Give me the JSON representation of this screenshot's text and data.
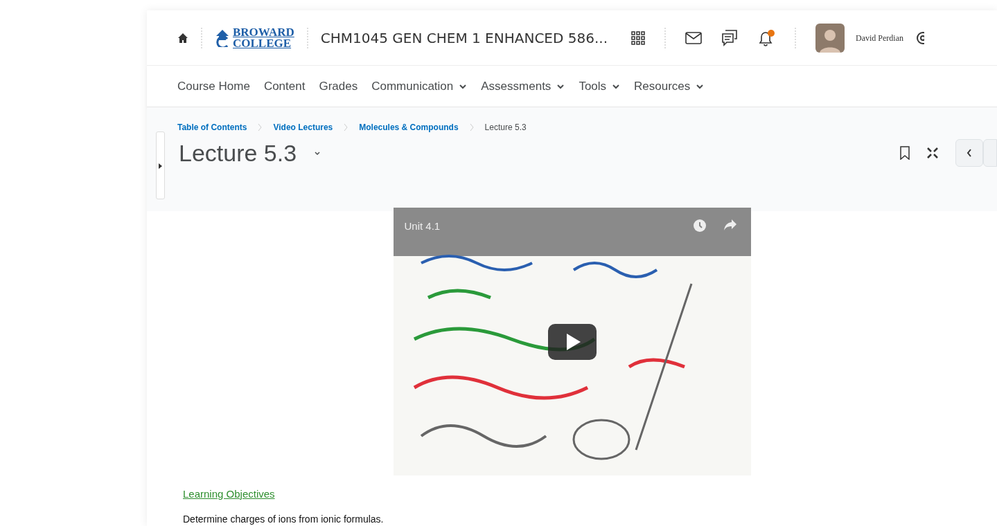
{
  "header": {
    "logo": [
      "BROWARD",
      "COLLEGE"
    ],
    "course_title": "CHM1045 GEN CHEM 1 ENHANCED 586...",
    "notifications_unread": true,
    "user_name": "David Perdian"
  },
  "nav": [
    {
      "label": "Course Home",
      "dropdown": false
    },
    {
      "label": "Content",
      "dropdown": false
    },
    {
      "label": "Grades",
      "dropdown": false
    },
    {
      "label": "Communication",
      "dropdown": true
    },
    {
      "label": "Assessments",
      "dropdown": true
    },
    {
      "label": "Tools",
      "dropdown": true
    },
    {
      "label": "Resources",
      "dropdown": true
    }
  ],
  "breadcrumbs": [
    {
      "label": "Table of Contents",
      "link": true
    },
    {
      "label": "Video Lectures",
      "link": true
    },
    {
      "label": "Molecules & Compounds",
      "link": true
    },
    {
      "label": "Lecture 5.3",
      "link": false
    }
  ],
  "page_title": "Lecture 5.3",
  "video": {
    "kind": "picture",
    "overlay_title": "Unit 4.1"
  },
  "objectives": {
    "heading": "Learning Objectives",
    "text": "Determine charges of ions from ionic formulas."
  }
}
